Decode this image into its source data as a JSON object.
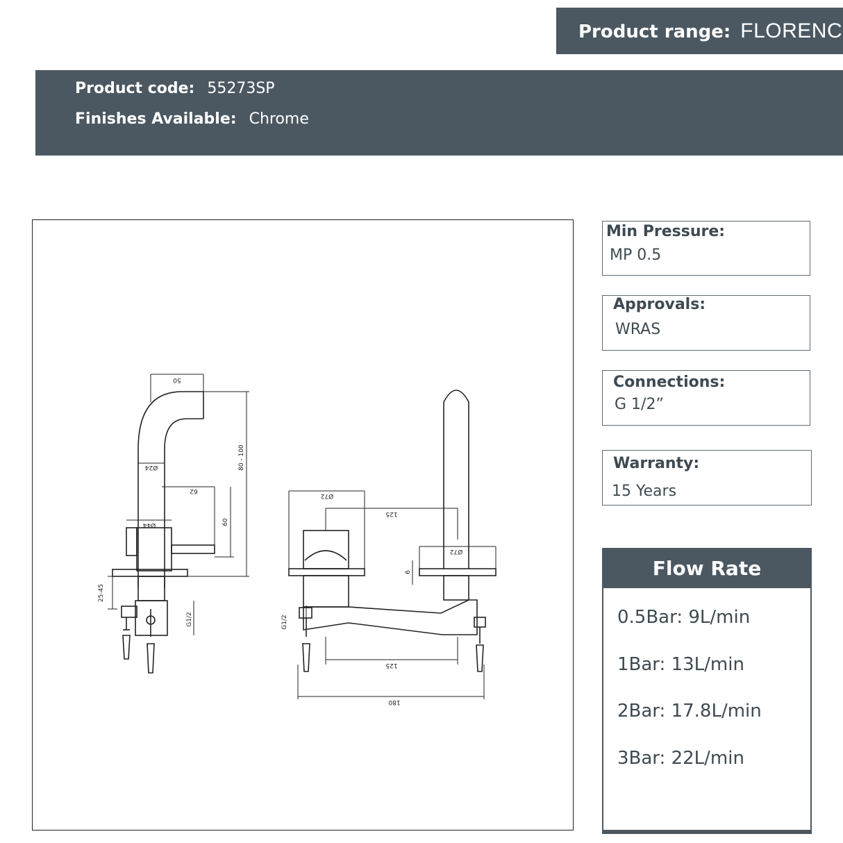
{
  "header": {
    "range_label": "Product range:",
    "range_value": "FLORENCE",
    "code_label": "Product code:",
    "code_value": "55273SP",
    "finish_label": "Finishes Available:",
    "finish_value": "Chrome"
  },
  "specs": {
    "min_pressure": {
      "label": "Min Pressure:",
      "value": "MP 0.5"
    },
    "approvals": {
      "label": "Approvals:",
      "value": "WRAS"
    },
    "connections": {
      "label": "Connections:",
      "value": "G 1/2”"
    },
    "warranty": {
      "label": "Warranty:",
      "value": "15 Years"
    }
  },
  "flow_rate": {
    "title": "Flow Rate",
    "items": [
      "0.5Bar: 9L/min",
      "1Bar: 13L/min",
      "2Bar: 17.8L/min",
      "3Bar: 22L/min"
    ]
  },
  "drawing": {
    "dims": {
      "spout_reach": "50",
      "spout_diameter": "Ø24",
      "height": "80 - 100",
      "lever_reach": "62",
      "lever_height": "60",
      "body_diameter": "Ø44",
      "deck_range": "25-45",
      "thread": "G1/2",
      "handle_diameter": "Ø72",
      "centres_top": "125",
      "spout_base_diameter": "Ø72",
      "plate": "6",
      "thread_front": "G1/2",
      "centres_bottom": "125",
      "overall": "180"
    }
  },
  "colors": {
    "band": "#4b5861",
    "text": "#3e4a52"
  }
}
